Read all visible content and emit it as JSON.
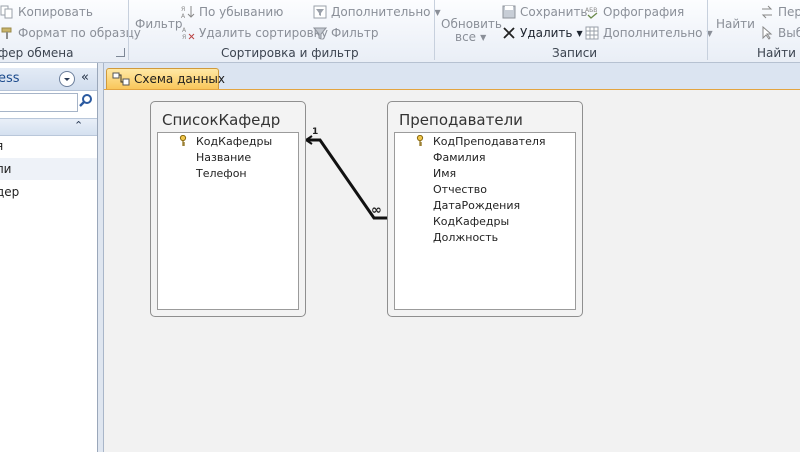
{
  "ribbon": {
    "clipboard": {
      "copy": "Копировать",
      "format_painter": "Формат по образцу",
      "label": "фер обмена"
    },
    "sort_filter": {
      "filter": "Фильтр",
      "descending": "По убыванию",
      "remove_sort": "Удалить сортировку",
      "advanced": "Дополнительно",
      "toggle_filter": "Фильтр",
      "label": "Сортировка и фильтр"
    },
    "records": {
      "refresh_line1": "Обновить",
      "refresh_line2": "все",
      "save": "Сохранить",
      "delete": "Удалить",
      "spelling": "Орфография",
      "more": "Дополнительно",
      "label": "Записи"
    },
    "find": {
      "find": "Найти",
      "replace": "Пере",
      "select": "Выб",
      "label": "Найти"
    }
  },
  "nav": {
    "title": "ess",
    "items": [
      {
        "label": "я"
      },
      {
        "label": "ли"
      },
      {
        "label": "дер"
      }
    ]
  },
  "document": {
    "tab_label": "Схема данных"
  },
  "tables": [
    {
      "title": "СписокКафедр",
      "fields": [
        {
          "name": "КодКафедры",
          "key": true
        },
        {
          "name": "Название",
          "key": false
        },
        {
          "name": "Телефон",
          "key": false
        }
      ]
    },
    {
      "title": "Преподаватели",
      "fields": [
        {
          "name": "КодПреподавателя",
          "key": true
        },
        {
          "name": "Фамилия",
          "key": false
        },
        {
          "name": "Имя",
          "key": false
        },
        {
          "name": "Отчество",
          "key": false
        },
        {
          "name": "ДатаРождения",
          "key": false
        },
        {
          "name": "КодКафедры",
          "key": false
        },
        {
          "name": "Должность",
          "key": false
        }
      ]
    }
  ],
  "relationship": {
    "one_label": "1",
    "many_label": "∞"
  },
  "colors": {
    "doc_tab": "#f9c65a",
    "ribbon_bg": "#e9eef6",
    "canvas_bg": "#f2f2f2"
  }
}
